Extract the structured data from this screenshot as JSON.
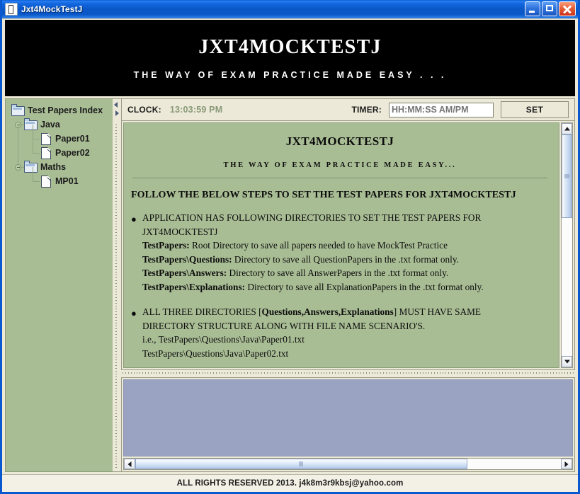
{
  "window": {
    "title": "Jxt4MockTestJ",
    "icon": "app-icon",
    "buttons": {
      "minimize": "minimize-icon",
      "maximize": "maximize-icon",
      "close": "close-icon"
    }
  },
  "banner": {
    "title": "JXT4MOCKTESTJ",
    "subtitle": "THE WAY OF EXAM PRACTICE MADE EASY . . ."
  },
  "sidebar": {
    "nodes": [
      {
        "label": "Test Papers Index",
        "level": 0,
        "type": "folder"
      },
      {
        "label": "Java",
        "level": 1,
        "type": "folder"
      },
      {
        "label": "Paper01",
        "level": 2,
        "type": "file"
      },
      {
        "label": "Paper02",
        "level": 2,
        "type": "file"
      },
      {
        "label": "Maths",
        "level": 1,
        "type": "folder"
      },
      {
        "label": "MP01",
        "level": 2,
        "type": "file"
      }
    ]
  },
  "toolbar": {
    "clock_label": "CLOCK:",
    "clock_value": "13:03:59 PM",
    "timer_label": "TIMER:",
    "timer_value": "",
    "timer_placeholder": "HH:MM:SS AM/PM",
    "set_label": "SET"
  },
  "document": {
    "title": "JXT4MOCKTESTJ",
    "subtitle": "THE WAY OF EXAM PRACTICE MADE EASY...",
    "heading": "FOLLOW THE BELOW STEPS TO SET THE TEST PAPERS FOR JXT4MOCKTESTJ",
    "bullets": [
      {
        "lines": [
          "APPLICATION HAS FOLLOWING DIRECTORIES TO SET THE TEST PAPERS FOR",
          "JXT4MOCKTESTJ"
        ],
        "defs": [
          {
            "term": "TestPapers:",
            "desc": " Root Directory to save all papers needed to have MockTest Practice"
          },
          {
            "term": "TestPapers\\Questions:",
            "desc": " Directory to save all QuestionPapers in the .txt format only."
          },
          {
            "term": "TestPapers\\Answers:",
            "desc": " Directory to save all AnswerPapers in the .txt format only."
          },
          {
            "term": "TestPapers\\Explanations:",
            "desc": " Directory to save all ExplanationPapers in the .txt format only."
          }
        ]
      },
      {
        "rich_line_pre": "ALL THREE DIRECTORIES [",
        "rich_line_bold": "Questions,Answers,Explanations",
        "rich_line_post": "] MUST HAVE SAME",
        "lines2": [
          "DIRECTORY STRUCTURE ALONG WITH FILE NAME SCENARIO'S.",
          "i.e., TestPapers\\Questions\\Java\\Paper01.txt",
          "TestPapers\\Questions\\Java\\Paper02.txt"
        ]
      }
    ]
  },
  "footer": {
    "text": "ALL RIGHTS RESERVED 2013. j4k8m3r9kbsj@yahoo.com"
  },
  "colors": {
    "titlebar_blue": "#0a57c8",
    "banner_black": "#000000",
    "pane_green": "#a9bd95",
    "lower_panel": "#9aa4c2",
    "chrome": "#ece9d8",
    "clock_value": "#8a9a78"
  }
}
